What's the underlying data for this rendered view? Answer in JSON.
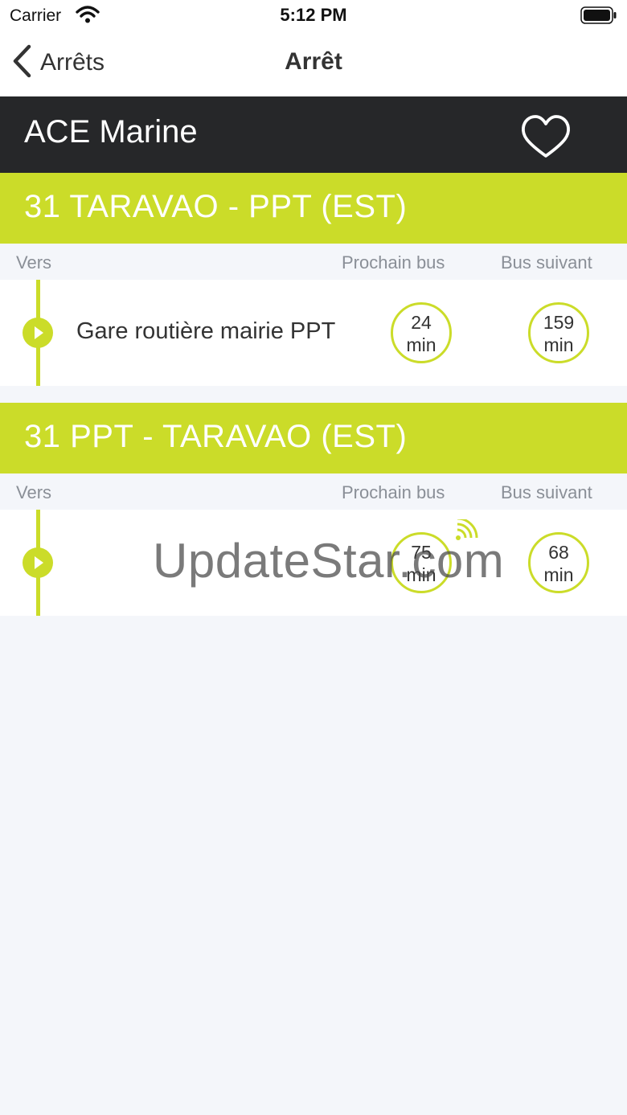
{
  "status_bar": {
    "carrier": "Carrier",
    "time": "5:12 PM"
  },
  "nav": {
    "back_label": "Arrêts",
    "title": "Arrêt"
  },
  "stop": {
    "name": "ACE Marine"
  },
  "lines": [
    {
      "title": "31 TARAVAO - PPT (EST)",
      "columns": {
        "to": "Vers",
        "next_bus": "Prochain bus",
        "following_bus": "Bus suivant"
      },
      "destination": "Gare routière mairie PPT",
      "next": {
        "value": "24",
        "unit": "min"
      },
      "following": {
        "value": "159",
        "unit": "min"
      }
    },
    {
      "title": "31 PPT - TARAVAO (EST)",
      "columns": {
        "to": "Vers",
        "next_bus": "Prochain bus",
        "following_bus": "Bus suivant"
      },
      "destination": "",
      "next": {
        "value": "75",
        "unit": "min",
        "realtime": true
      },
      "following": {
        "value": "68",
        "unit": "min"
      }
    }
  ],
  "watermark": "UpdateStar.com",
  "colors": {
    "accent": "#cbdc29",
    "header_dark": "#262729",
    "background": "#f4f6fa",
    "text": "#333333",
    "muted": "#8a8f97"
  },
  "icons": [
    "wifi-icon",
    "battery-icon",
    "chevron-left-icon",
    "heart-icon",
    "play-arrow-icon",
    "realtime-signal-icon"
  ]
}
